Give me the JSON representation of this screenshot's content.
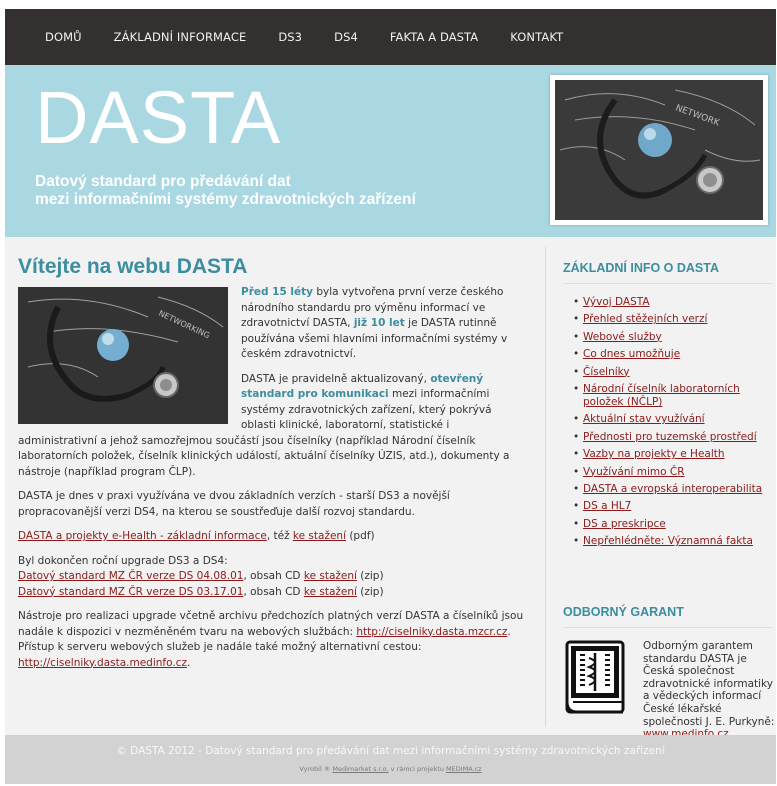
{
  "nav": {
    "items": [
      {
        "label": "DOMŮ"
      },
      {
        "label": "ZÁKLADNÍ INFORMACE"
      },
      {
        "label": "DS3"
      },
      {
        "label": "DS4"
      },
      {
        "label": "FAKTA A DASTA"
      },
      {
        "label": "KONTAKT"
      }
    ]
  },
  "hero": {
    "title": "DASTA",
    "subtitle_line1": "Datový standard pro předávání dat",
    "subtitle_line2": "mezi informačními systémy zdravotnických zařízení"
  },
  "main": {
    "heading": "Vítejte na webu DASTA",
    "p1": {
      "hl1": "Před 15 léty",
      "t1": " byla vytvořena první verze českého národního standardu pro výměnu informací ve zdravotnictví DASTA, ",
      "hl2": "již 10 let",
      "t2": " je DASTA rutinně používána všemi hlavními informačními systémy v českém zdravotnictví."
    },
    "p2": {
      "t1": "DASTA je pravidelně aktualizovaný, ",
      "hl1": "otevřený standard pro komunikaci",
      "t2": " mezi informačními systémy zdravotnických zařízení, který pokrývá oblasti klinické, laboratorní, statistické i administrativní a jehož samozřejmou součástí jsou číselníky (například Národní číselník laboratorních položek, číselník klinických událostí, aktuální číselníky ÚZIS, atd.), dokumenty a nástroje (například program ČLP)."
    },
    "p3": "DASTA je dnes v praxi využívána ve dvou základních verzích - starší DS3 a novější propracovanější verzi DS4, na kterou se soustřeďuje další rozvoj standardu.",
    "p4": {
      "link1": "DASTA a projekty e-Health - základní informace",
      "t1": ", též ",
      "link2": "ke stažení",
      "t2": " (pdf)"
    },
    "p5": {
      "intro": "Byl dokončen roční upgrade DS3 a DS4:",
      "link1": "Datový standard MZ ČR verze DS 04.08.01",
      "t1": ", obsah CD ",
      "link2": "ke stažení",
      "t2": " (zip)",
      "link3": "Datový standard MZ ČR verze DS 03.17.01",
      "t3": ", obsah CD ",
      "link4": "ke stažení",
      "t4": " (zip)"
    },
    "p6": {
      "t1": "Nástroje pro realizaci upgrade včetně archivu předchozích platných verzí DASTA a číselníků jsou nadále k dispozici v nezměněném tvaru na webových službách: ",
      "link1": "http://ciselniky.dasta.mzcr.cz",
      "t2": ".",
      "t3": "Přístup k serveru webových služeb je nadále také možný alternativní cestou:",
      "link2": "http://ciselniky.dasta.medinfo.cz",
      "t4": "."
    }
  },
  "sidebar": {
    "heading": "ZÁKLADNÍ INFO O DASTA",
    "items": [
      {
        "label": "Vývoj DASTA"
      },
      {
        "label": "Přehled stěžejních verzí"
      },
      {
        "label": "Webové služby"
      },
      {
        "label": "Co dnes umožňuje"
      },
      {
        "label": "Číselníky"
      },
      {
        "label": "Národní číselník laboratorních položek (NČLP)"
      },
      {
        "label": "Aktuální stav využívání"
      },
      {
        "label": "Přednosti pro tuzemské prostředí"
      },
      {
        "label": "Vazby na projekty e Health"
      },
      {
        "label": "Využívání mimo ČR"
      },
      {
        "label": "DASTA a evropská interoperabilita"
      },
      {
        "label": "DS a HL7"
      },
      {
        "label": "DS a preskripce"
      },
      {
        "label": "Nepřehlédněte: Významná fakta"
      }
    ],
    "garant_heading": "ODBORNÝ GARANT",
    "garant_text": "Odborným garantem standardu DASTA je Česká společnost zdravotnické informatiky a vědeckých informací České lékařské společnosti J. E. Purkyně:",
    "garant_link": "www.medinfo.cz"
  },
  "footer": {
    "line1": "© DASTA 2012 - Datový standard pro předávání dat mezi informačními systémy zdravotnických zařízení",
    "line2_t1": "Vyrobil ® ",
    "line2_link1": "Medimarket s.r.o.",
    "line2_t2": " v rámci projektu ",
    "line2_link2": "MEDIMA.cz"
  },
  "colors": {
    "nav_bg": "#353030",
    "hero_bg": "#a9d8e2",
    "accent": "#3c8da0",
    "link": "#8b1a1a",
    "footer_bg": "#d2d2d2"
  }
}
